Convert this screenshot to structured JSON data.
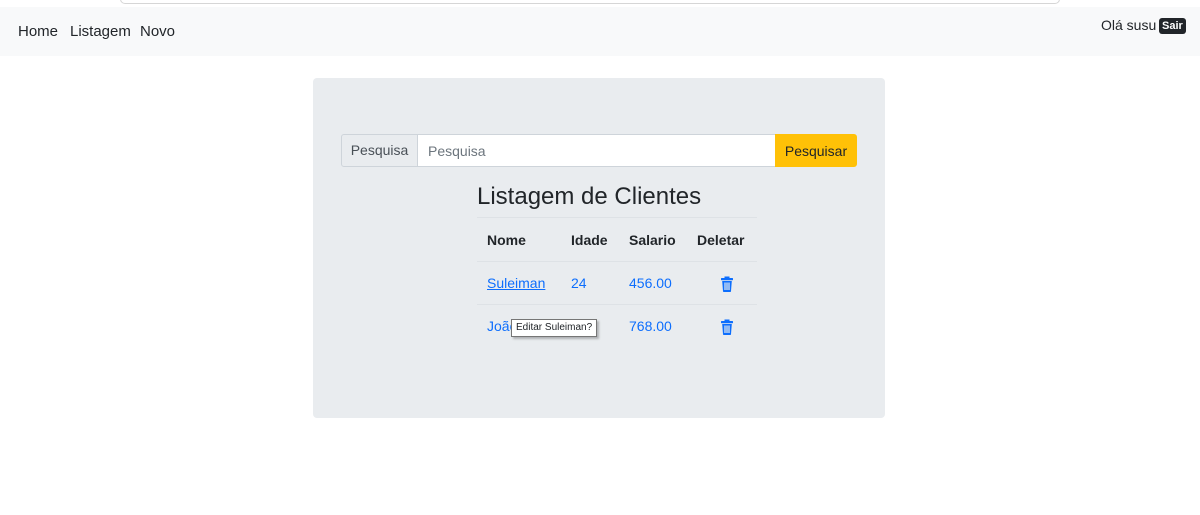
{
  "navbar": {
    "links": [
      "Home",
      "Listagem",
      "Novo"
    ],
    "greeting": "Olá susu",
    "logout_label": "Sair"
  },
  "search": {
    "prefix_label": "Pesquisa",
    "placeholder": "Pesquisa",
    "value": "",
    "button_label": "Pesquisar"
  },
  "page": {
    "title": "Listagem de Clientes"
  },
  "table": {
    "headers": [
      "Nome",
      "Idade",
      "Salario",
      "Deletar"
    ],
    "rows": [
      {
        "nome": "Suleiman",
        "idade": "24",
        "salario": "456.00"
      },
      {
        "nome": "João",
        "idade": "",
        "salario": "768.00"
      }
    ]
  },
  "tooltip": {
    "text": "Editar Suleiman?"
  },
  "colors": {
    "navbar_bg": "#f8f9fa",
    "panel_bg": "#e9ecef",
    "accent": "#0d6efd",
    "search_button": "#ffc107"
  },
  "icons": {
    "delete": "trash-icon"
  }
}
